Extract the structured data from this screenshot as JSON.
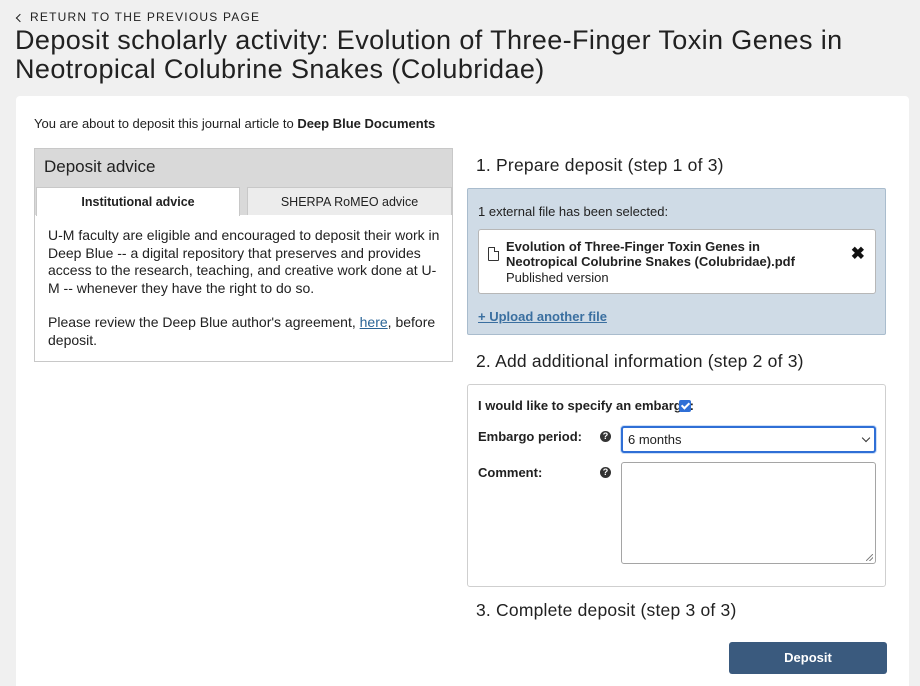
{
  "nav": {
    "back_label": "RETURN TO THE PREVIOUS PAGE"
  },
  "page": {
    "title": "Deposit scholarly activity: Evolution of Three-Finger Toxin Genes in Neotropical Colubrine Snakes (Colubridae)"
  },
  "intro": {
    "prefix": "You are about to deposit this journal article to ",
    "repository": "Deep Blue Documents"
  },
  "advice": {
    "heading": "Deposit advice",
    "tabs": [
      {
        "label": "Institutional advice",
        "active": true
      },
      {
        "label": "SHERPA RoMEO advice",
        "active": false
      }
    ],
    "paragraph1": "U-M faculty are eligible and encouraged to deposit their work in Deep Blue -- a digital repository that preserves and provides access to the research, teaching, and creative work done at U-M -- whenever they have the right to do so.",
    "paragraph2_prefix": "Please review the Deep Blue author's agreement, ",
    "paragraph2_link": "here",
    "paragraph2_suffix": ", before deposit."
  },
  "step1": {
    "title": "1. Prepare deposit (step 1 of 3)",
    "selected_note": "1 external file has been selected:",
    "file": {
      "name": "Evolution of Three-Finger Toxin Genes in Neotropical Colubrine Snakes (Colubridae).pdf",
      "version": "Published version",
      "icon": "document-icon",
      "remove_icon": "close-x-icon"
    },
    "upload_link": "+ Upload another file"
  },
  "step2": {
    "title": "2. Add additional information (step 2 of 3)",
    "embargo_label": "I would like to specify an embargo:",
    "embargo_checked": true,
    "embargo_period_label": "Embargo period:",
    "embargo_period_value": "6 months",
    "comment_label": "Comment:",
    "comment_value": "",
    "help_icon": "?"
  },
  "step3": {
    "title": "3. Complete deposit (step 3 of 3)"
  },
  "actions": {
    "deposit_label": "Deposit"
  },
  "colors": {
    "accent": "#2f6fd6",
    "panel": "#cfdbe6",
    "button": "#3a5a7e",
    "link": "#3a6fa0"
  }
}
